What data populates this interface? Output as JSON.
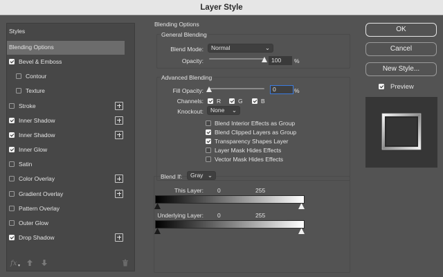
{
  "window": {
    "title": "Layer Style"
  },
  "styles_panel": {
    "header": "Styles",
    "items": [
      {
        "label": "Blending Options",
        "has_checkbox": false,
        "checked": false,
        "indent": false,
        "has_plus": false,
        "selected": true
      },
      {
        "label": "Bevel & Emboss",
        "has_checkbox": true,
        "checked": true,
        "indent": false,
        "has_plus": false,
        "selected": false
      },
      {
        "label": "Contour",
        "has_checkbox": true,
        "checked": false,
        "indent": true,
        "has_plus": false,
        "selected": false
      },
      {
        "label": "Texture",
        "has_checkbox": true,
        "checked": false,
        "indent": true,
        "has_plus": false,
        "selected": false
      },
      {
        "label": "Stroke",
        "has_checkbox": true,
        "checked": false,
        "indent": false,
        "has_plus": true,
        "selected": false
      },
      {
        "label": "Inner Shadow",
        "has_checkbox": true,
        "checked": true,
        "indent": false,
        "has_plus": true,
        "selected": false
      },
      {
        "label": "Inner Shadow",
        "has_checkbox": true,
        "checked": true,
        "indent": false,
        "has_plus": true,
        "selected": false
      },
      {
        "label": "Inner Glow",
        "has_checkbox": true,
        "checked": true,
        "indent": false,
        "has_plus": false,
        "selected": false
      },
      {
        "label": "Satin",
        "has_checkbox": true,
        "checked": false,
        "indent": false,
        "has_plus": false,
        "selected": false
      },
      {
        "label": "Color Overlay",
        "has_checkbox": true,
        "checked": false,
        "indent": false,
        "has_plus": true,
        "selected": false
      },
      {
        "label": "Gradient Overlay",
        "has_checkbox": true,
        "checked": false,
        "indent": false,
        "has_plus": true,
        "selected": false
      },
      {
        "label": "Pattern Overlay",
        "has_checkbox": true,
        "checked": false,
        "indent": false,
        "has_plus": false,
        "selected": false
      },
      {
        "label": "Outer Glow",
        "has_checkbox": true,
        "checked": false,
        "indent": false,
        "has_plus": false,
        "selected": false
      },
      {
        "label": "Drop Shadow",
        "has_checkbox": true,
        "checked": true,
        "indent": false,
        "has_plus": true,
        "selected": false
      }
    ],
    "footer": {
      "fx_label": "fx",
      "fx_caret": "▾"
    }
  },
  "blending_options": {
    "section_title": "Blending Options",
    "general": {
      "title": "General Blending",
      "blend_mode_label": "Blend Mode:",
      "blend_mode_value": "Normal",
      "opacity_label": "Opacity:",
      "opacity_value": "100",
      "opacity_level": 1.0,
      "percent": "%"
    },
    "advanced": {
      "title": "Advanced Blending",
      "fill_opacity_label": "Fill Opacity:",
      "fill_opacity_value": "0",
      "fill_opacity_level": 0.0,
      "percent": "%",
      "channels_label": "Channels:",
      "channels": [
        {
          "label": "R",
          "checked": true
        },
        {
          "label": "G",
          "checked": true
        },
        {
          "label": "B",
          "checked": true
        }
      ],
      "knockout_label": "Knockout:",
      "knockout_value": "None",
      "options": [
        {
          "label": "Blend Interior Effects as Group",
          "checked": false
        },
        {
          "label": "Blend Clipped Layers as Group",
          "checked": true
        },
        {
          "label": "Transparency Shapes Layer",
          "checked": true
        },
        {
          "label": "Layer Mask Hides Effects",
          "checked": false
        },
        {
          "label": "Vector Mask Hides Effects",
          "checked": false
        }
      ]
    },
    "blend_if": {
      "label": "Blend If:",
      "value": "Gray",
      "this_layer_label": "This Layer:",
      "this_layer_min": "0",
      "this_layer_max": "255",
      "underlying_label": "Underlying Layer:",
      "underlying_min": "0",
      "underlying_max": "255"
    }
  },
  "buttons": {
    "ok": "OK",
    "cancel": "Cancel",
    "new_style": "New Style...",
    "preview_label": "Preview",
    "preview_checked": true
  },
  "colors": {
    "accent": "#3a7be0",
    "dialog_bg": "#535353",
    "panel_bg": "#474747",
    "selected_bg": "#6c6c6c"
  }
}
